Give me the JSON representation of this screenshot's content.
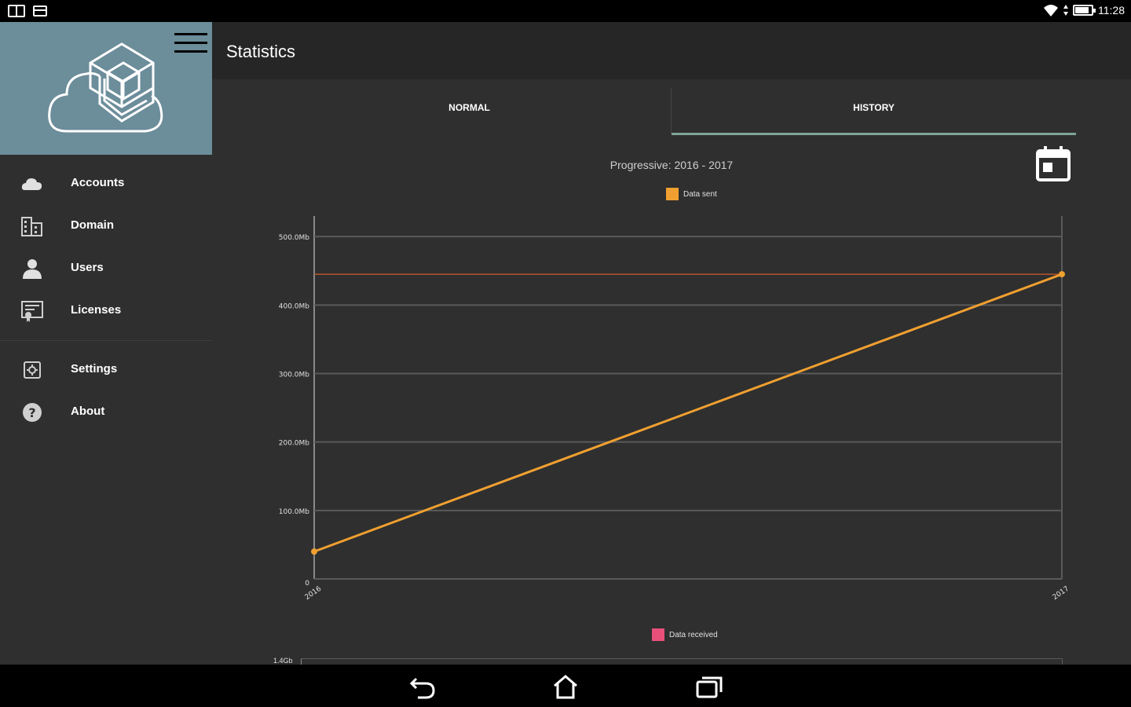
{
  "status_bar": {
    "time": "11:28",
    "left_icons": [
      "reader-icon",
      "card-icon"
    ],
    "right_icons": [
      "wifi-icon",
      "data-icon",
      "battery-icon"
    ]
  },
  "app_bar": {
    "title": "Statistics"
  },
  "drawer": {
    "header_color": "#6c8d9a",
    "items": [
      {
        "label": "Accounts",
        "icon": "cloud-icon"
      },
      {
        "label": "Domain",
        "icon": "building-icon"
      },
      {
        "label": "Users",
        "icon": "user-icon"
      },
      {
        "label": "Licenses",
        "icon": "certificate-icon"
      }
    ],
    "secondary_items": [
      {
        "label": "Settings",
        "icon": "gear-icon"
      },
      {
        "label": "About",
        "icon": "help-icon"
      }
    ]
  },
  "tabs": [
    {
      "label": "NORMAL",
      "active": false
    },
    {
      "label": "HISTORY",
      "active": true
    }
  ],
  "accent_color": "#7da49a",
  "chart_title": "Progressive: 2016 - 2017",
  "chart_data": {
    "type": "line",
    "x": [
      "2016",
      "2017"
    ],
    "series": [
      {
        "name": "Data sent",
        "color": "#f0a030",
        "values": [
          40,
          445
        ]
      }
    ],
    "reference_line": {
      "value": 445,
      "color": "#b8542e"
    },
    "y_tick_labels": [
      "0",
      "100.0Mb",
      "200.0Mb",
      "300.0Mb",
      "400.0Mb",
      "500.0Mb"
    ],
    "y_ticks": [
      0,
      100,
      200,
      300,
      400,
      500
    ],
    "ylim": [
      0,
      530
    ],
    "grid": true,
    "legend_position": "top-center"
  },
  "second_chart": {
    "legend_label": "Data received",
    "legend_color": "#e8507a",
    "first_tick_label": "1.4Gb"
  },
  "nav_bar": {
    "buttons": [
      "back-icon",
      "home-icon",
      "recents-icon"
    ]
  }
}
